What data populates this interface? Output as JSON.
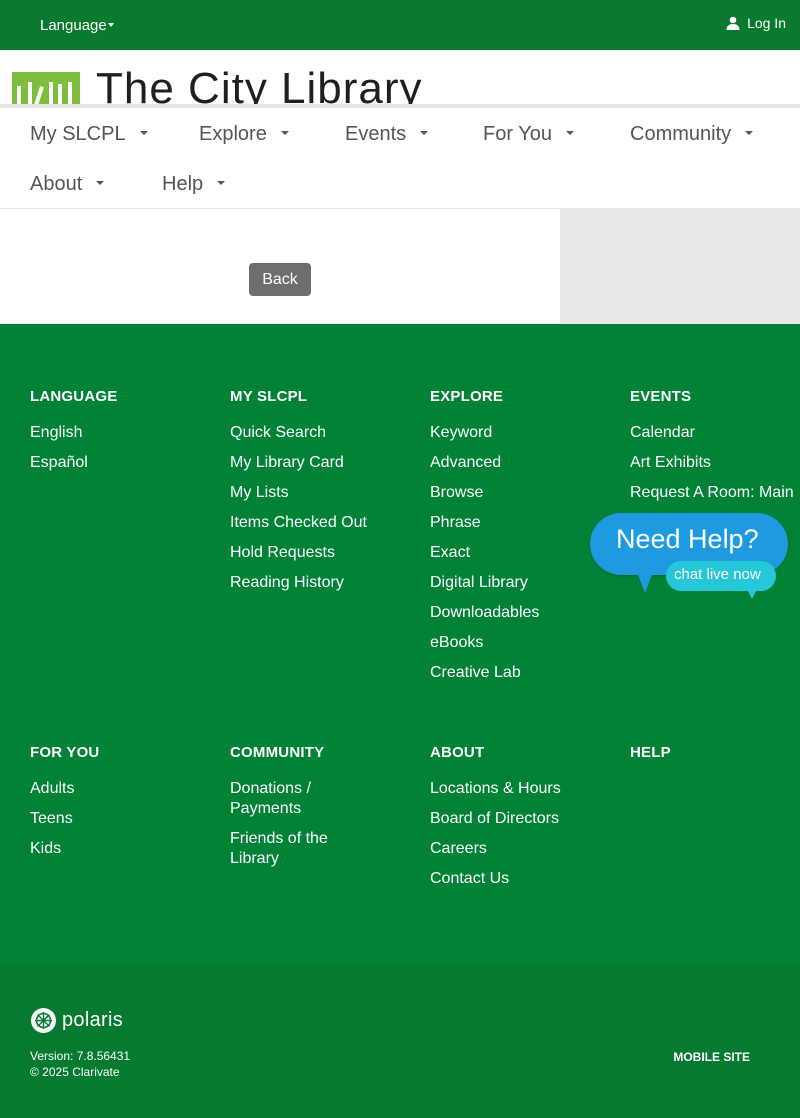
{
  "topbar": {
    "language_label": "Language",
    "login_label": "Log In"
  },
  "logo": {
    "title": "The City Library",
    "color": "#7dbe3c"
  },
  "nav": {
    "items": [
      {
        "label": "My SLCPL"
      },
      {
        "label": "Explore"
      },
      {
        "label": "Events"
      },
      {
        "label": "For You"
      },
      {
        "label": "Community"
      },
      {
        "label": "About"
      },
      {
        "label": "Help"
      }
    ]
  },
  "content": {
    "back_label": "Back"
  },
  "footer": {
    "columns": [
      {
        "heading": "LANGUAGE",
        "links": [
          "English",
          "Español"
        ]
      },
      {
        "heading": "MY SLCPL",
        "links": [
          "Quick Search",
          "My Library Card",
          "My Lists",
          "Items Checked Out",
          "Hold Requests",
          "Reading History"
        ]
      },
      {
        "heading": "EXPLORE",
        "links": [
          "Keyword",
          "Advanced",
          "Browse",
          "Phrase",
          "Exact",
          "Digital Library",
          "Downloadables",
          "eBooks",
          "Creative Lab"
        ]
      },
      {
        "heading": "EVENTS",
        "links": [
          "Calendar",
          "Art Exhibits",
          "Request A Room: Main"
        ]
      },
      {
        "heading": "FOR YOU",
        "links": [
          "Adults",
          "Teens",
          "Kids"
        ]
      },
      {
        "heading": "COMMUNITY",
        "links": [
          "Donations / Payments",
          "Friends of the Library"
        ]
      },
      {
        "heading": "ABOUT",
        "links": [
          "Locations & Hours",
          "Board of Directors",
          "Careers",
          "Contact Us"
        ]
      },
      {
        "heading": "HELP",
        "links": []
      }
    ]
  },
  "chat": {
    "title": "Need Help?",
    "subtitle": "chat live now"
  },
  "bottom": {
    "brand": "polaris",
    "version": "Version: 7.8.56431",
    "copyright": "© 2025 Clarivate",
    "mobile_label": "MOBILE SITE"
  },
  "colors": {
    "topbar": "#0a7a2f",
    "footer": "#028236",
    "bottom": "#067a30",
    "chat_bubble": "#1e9be0",
    "chat_secondary": "#26c7d9"
  }
}
